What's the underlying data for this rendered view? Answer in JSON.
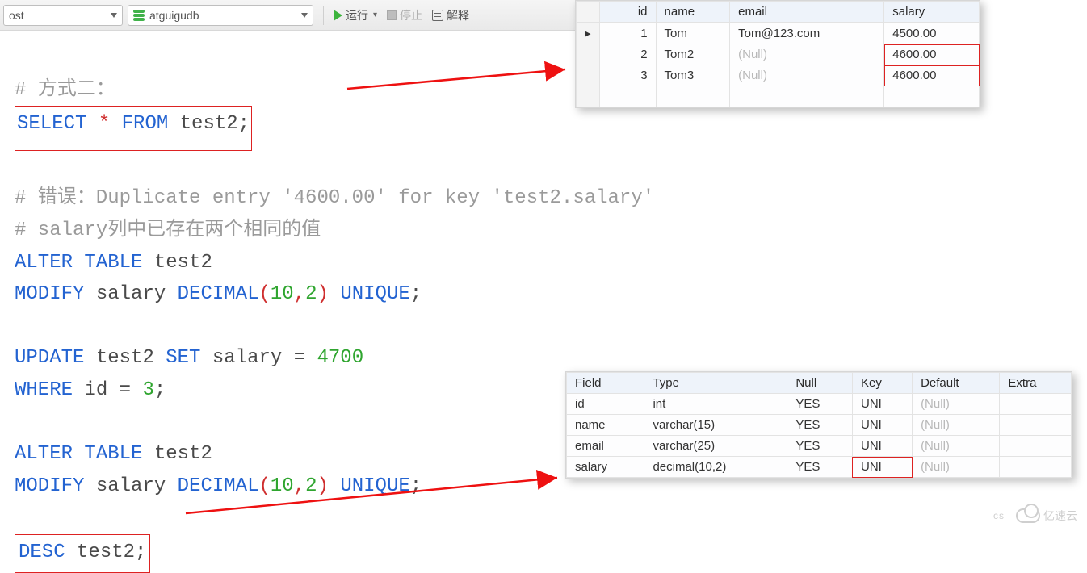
{
  "toolbar": {
    "host": "ost",
    "db": "atguigudb",
    "run": "运行",
    "stop": "停止",
    "explain": "解释"
  },
  "code": {
    "l1": "# 方式二：",
    "l2a": "SELECT",
    "l2b": "*",
    "l2c": "FROM",
    "l2d": "test2;",
    "l4a": "# 错误：Duplicate entry ",
    "l4b": "'4600.00'",
    "l4c": " for key ",
    "l4d": "'test2.salary'",
    "l5": "# salary列中已存在两个相同的值",
    "l6a": "ALTER",
    "l6b": "TABLE",
    "l6c": "test2",
    "l7a": "MODIFY",
    "l7b": "salary",
    "l7c": "DECIMAL",
    "l7d": "(",
    "l7e": "10",
    "l7f": ",",
    "l7g": "2",
    "l7h": ")",
    "l7i": "UNIQUE",
    "l7j": ";",
    "l9a": "UPDATE",
    "l9b": "test2",
    "l9c": "SET",
    "l9d": "salary =",
    "l9e": "4700",
    "l10a": "WHERE",
    "l10b": "id =",
    "l10c": "3",
    "l10d": ";",
    "l12a": "ALTER",
    "l12b": "TABLE",
    "l12c": "test2",
    "l13a": "MODIFY",
    "l13b": "salary",
    "l13c": "DECIMAL",
    "l13d": "(",
    "l13e": "10",
    "l13f": ",",
    "l13g": "2",
    "l13h": ")",
    "l13i": "UNIQUE",
    "l13j": ";",
    "l15a": "DESC",
    "l15b": "test2;"
  },
  "result1": {
    "headers": {
      "id": "id",
      "name": "name",
      "email": "email",
      "salary": "salary"
    },
    "rows": [
      {
        "id": "1",
        "name": "Tom",
        "email": "Tom@123.com",
        "salary": "4500.00",
        "hl": false,
        "arrow": true
      },
      {
        "id": "2",
        "name": "Tom2",
        "email": "(Null)",
        "salary": "4600.00",
        "hl": true,
        "arrow": false
      },
      {
        "id": "3",
        "name": "Tom3",
        "email": "(Null)",
        "salary": "4600.00",
        "hl": true,
        "arrow": false
      }
    ]
  },
  "result2": {
    "headers": {
      "field": "Field",
      "type": "Type",
      "null": "Null",
      "key": "Key",
      "default": "Default",
      "extra": "Extra"
    },
    "rows": [
      {
        "field": "id",
        "type": "int",
        "null": "YES",
        "key": "UNI",
        "default": "(Null)",
        "extra": "",
        "hl": false
      },
      {
        "field": "name",
        "type": "varchar(15)",
        "null": "YES",
        "key": "UNI",
        "default": "(Null)",
        "extra": "",
        "hl": false
      },
      {
        "field": "email",
        "type": "varchar(25)",
        "null": "YES",
        "key": "UNI",
        "default": "(Null)",
        "extra": "",
        "hl": false
      },
      {
        "field": "salary",
        "type": "decimal(10,2)",
        "null": "YES",
        "key": "UNI",
        "default": "(Null)",
        "extra": "",
        "hl": true
      }
    ]
  },
  "watermark": {
    "cs": "cs",
    "brand": "亿速云"
  }
}
